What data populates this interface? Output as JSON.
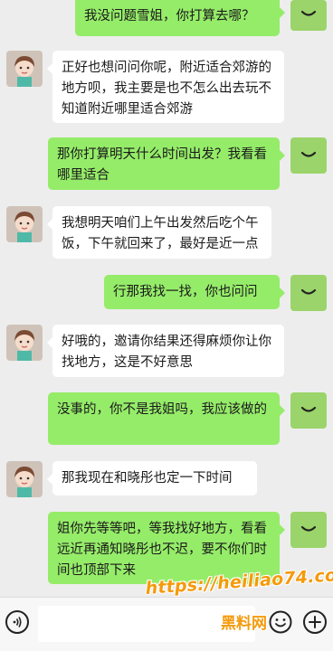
{
  "messages": [
    {
      "side": "right",
      "text": "我没问题雪姐，你打算去哪？"
    },
    {
      "side": "left",
      "text": "正好也想问问你呢，附近适合郊游的地方呗，我主要是也不怎么出去玩不知道附近哪里适合郊游"
    },
    {
      "side": "right",
      "text": "那你打算明天什么时间出发？我看看哪里适合"
    },
    {
      "side": "left",
      "text": "我想明天咱们上午出发然后吃个午饭，下午就回来了，最好是近一点"
    },
    {
      "side": "right",
      "text": "行那我找一找，你也问问"
    },
    {
      "side": "left",
      "text": "好哦的，邀请你结果还得麻烦你让你找地方，这是不好意思"
    },
    {
      "side": "right",
      "text": "没事的，你不是我姐吗，我应该做的"
    },
    {
      "side": "left",
      "text": "那我现在和晓彤也定一下时间"
    },
    {
      "side": "right",
      "text": "姐你先等等吧，等我找好地方，看看远近再通知晓彤也不迟，要不你们时间也顶部下来"
    }
  ],
  "watermark": {
    "url": "https://heiliao74.com",
    "name": "黑料网"
  },
  "icons": {
    "voice": "voice-icon",
    "emoji": "emoji-icon",
    "plus": "plus-icon",
    "right_avatar": "smile-avatar-icon"
  },
  "colors": {
    "sent_bubble": "#95ec69",
    "received_bubble": "#ffffff",
    "background": "#ededed",
    "watermark": "#f59a0c"
  }
}
